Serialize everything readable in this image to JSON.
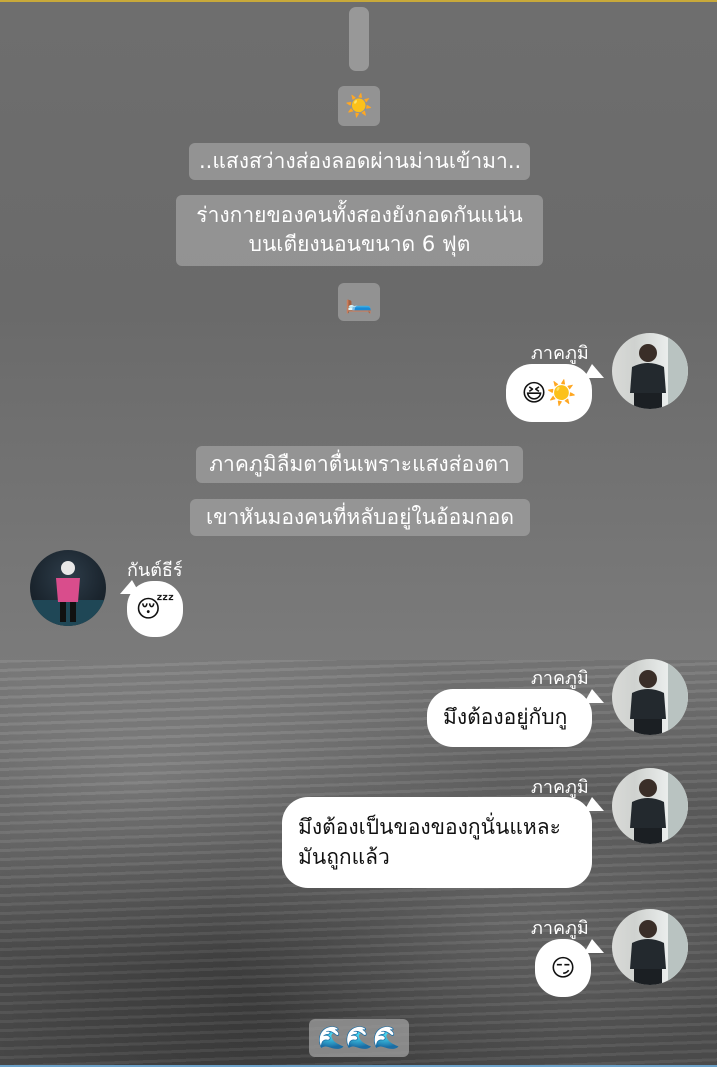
{
  "handle": {},
  "events": {
    "sun_emoji": "☀️",
    "narration_1": "..แสงสว่างส่องลอดผ่านม่านเข้ามา..",
    "narration_2_line1": "ร่างกายของคนทั้งสองยังกอดกันแน่น",
    "narration_2_line2": "บนเตียงนอนขนาด 6 ฟุต",
    "bed_emoji": "🛏️",
    "narration_3": "ภาคภูมิลืมตาตื่นเพราะแสงส่องตา",
    "narration_4": "เขาหันมองคนที่หลับอยู่ในอ้อมกอด",
    "waves_emoji": "🌊🌊🌊"
  },
  "messages": [
    {
      "side": "right",
      "sender": "ภาคภูมิ",
      "text": "😆☀️"
    },
    {
      "side": "left",
      "sender": "กันต์ธีร์",
      "text": "😴"
    },
    {
      "side": "right",
      "sender": "ภาคภูมิ",
      "text": "มึงต้องอยู่กับกู"
    },
    {
      "side": "right",
      "sender": "ภาคภูมิ",
      "line1": "มึงต้องเป็นของของกูนั่นแหละ",
      "line2": "มันถูกแล้ว"
    },
    {
      "side": "right",
      "sender": "ภาคภูมิ",
      "text": "😏"
    }
  ],
  "colors": {
    "bubble": "#ffffff",
    "pill": "#a0a0a0",
    "top_border": "#c8a93a"
  }
}
